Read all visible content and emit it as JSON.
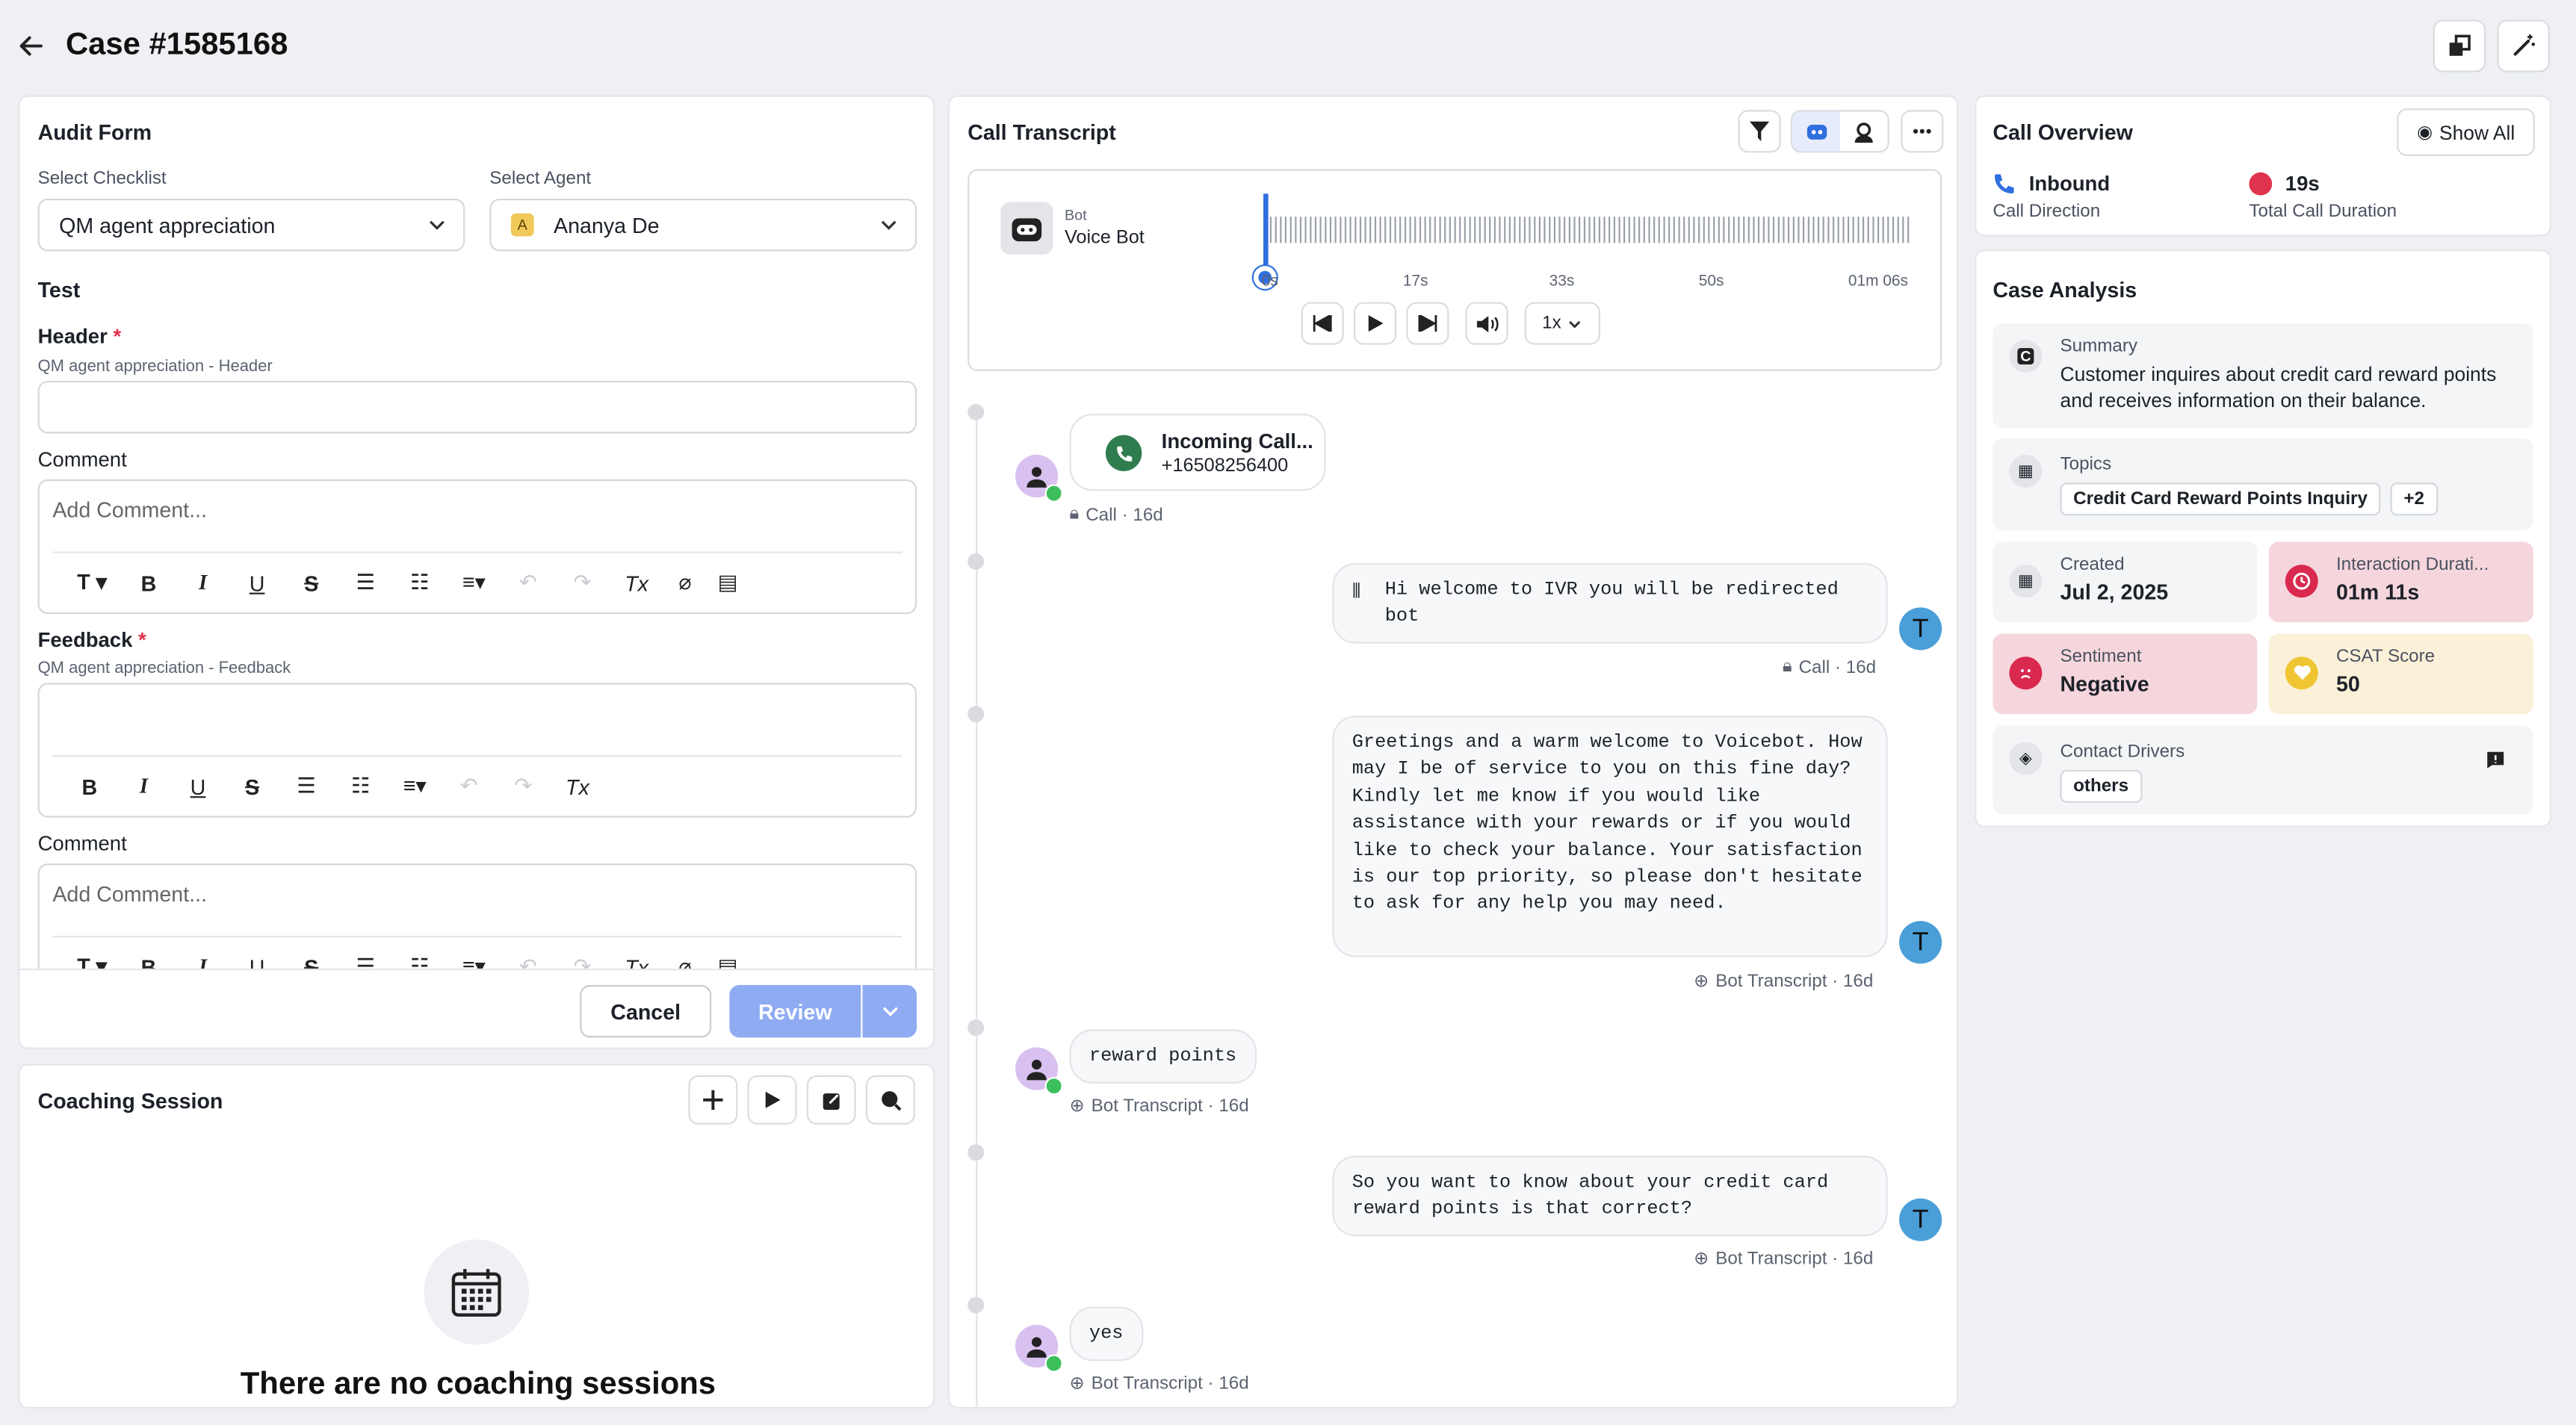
{
  "header": {
    "title": "Case #1585168"
  },
  "audit": {
    "title": "Audit Form",
    "checklist_label": "Select Checklist",
    "checklist_value": "QM agent appreciation",
    "agent_label": "Select Agent",
    "agent_initial": "A",
    "agent_value": "Ananya De",
    "section": "Test",
    "header_label": "Header",
    "header_sub": "QM agent appreciation - Header",
    "comment_label": "Comment",
    "comment_placeholder": "Add Comment...",
    "feedback_label": "Feedback",
    "feedback_sub": "QM agent appreciation - Feedback",
    "comment2_label": "Comment",
    "comment2_placeholder": "Add Comment...",
    "required_mark": "*",
    "cancel": "Cancel",
    "review": "Review"
  },
  "coaching": {
    "title": "Coaching Session",
    "empty": "There are no coaching sessions"
  },
  "transcript": {
    "title": "Call Transcript",
    "player": {
      "role": "Bot",
      "name": "Voice Bot",
      "ticks": [
        "0s",
        "17s",
        "33s",
        "50s",
        "01m 06s"
      ],
      "speed": "1x",
      "progress": 0
    },
    "incoming_title": "Incoming Call...",
    "incoming_number": "+16508256400",
    "meta1": "Call · 16d",
    "msg1": "Hi welcome to IVR you will be redirected bot",
    "meta2": "Call · 16d",
    "msg2": "Greetings and a warm welcome to Voicebot. How may I be of service to you on this fine day? Kindly let me know if you would like assistance with your rewards or if you would like to check your balance. Your satisfaction is our top priority, so please don't hesitate to ask for any help you may need.",
    "meta3": "Bot Transcript · 16d",
    "msg3": "reward points",
    "meta4": "Bot Transcript · 16d",
    "msg4": "So you want to know about your credit card reward points is that correct?",
    "meta5": "Bot Transcript · 16d",
    "msg5": "yes",
    "meta6": "Bot Transcript · 16d",
    "avatar_t": "T"
  },
  "overview": {
    "title": "Call Overview",
    "show_all": "Show All",
    "direction_value": "Inbound",
    "direction_label": "Call Direction",
    "duration_value": "19s",
    "duration_label": "Total Call Duration"
  },
  "analysis": {
    "title": "Case Analysis",
    "summary_label": "Summary",
    "summary_text": "Customer inquires about credit card reward points and receives information on their balance.",
    "topics_label": "Topics",
    "topic_chip": "Credit Card Reward Points Inquiry",
    "topic_more": "+2",
    "created_label": "Created",
    "created_value": "Jul 2, 2025",
    "interaction_label": "Interaction Durati...",
    "interaction_value": "01m 11s",
    "sentiment_label": "Sentiment",
    "sentiment_value": "Negative",
    "csat_label": "CSAT Score",
    "csat_value": "50",
    "drivers_label": "Contact Drivers",
    "drivers_chip": "others"
  },
  "colors": {
    "accent": "#2f6fe0",
    "review_bg": "#8fabf2",
    "negative_bg": "#f6d6dd",
    "csat_bg": "#fbf1d9"
  }
}
